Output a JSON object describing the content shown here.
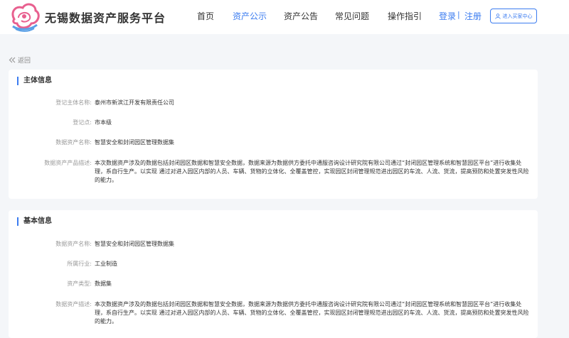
{
  "header": {
    "site_title": "无锡数据资产服务平台",
    "nav": [
      "首页",
      "资产公示",
      "资产公告",
      "常见问题",
      "操作指引"
    ],
    "active_nav": "资产公示",
    "login": "登录",
    "separator": "|",
    "register": "注册",
    "buyer_center": "进入买家中心"
  },
  "back_label": "返回",
  "subject_info": {
    "title": "主体信息",
    "rows": [
      {
        "label": "登记主体名称:",
        "value": "泰州市新滨江开发有限责任公司"
      },
      {
        "label": "登记点:",
        "value": "市本级"
      },
      {
        "label": "数据资产名称:",
        "value": "智慧安全和封闭园区管理数据集"
      },
      {
        "label": "数据资产产品描述:",
        "value": "本次数据资产涉及的数据包括封闭园区数据和智慧安全数据，数据来源为数据供方委托中通服咨询设计研究院有限公司通过“封闭园区管理系统和智慧园区平台”进行收集处理，系自行生产。以实现 通过对进入园区内部的人员、车辆、货物的立体化、全覆盖管控，实现园区封闭管理规范进出园区的车流、人流、货流，提高预防和处置突发性风险的能力。"
      }
    ]
  },
  "basic_info": {
    "title": "基本信息",
    "rows": [
      {
        "label": "数据资产名称:",
        "value": "智慧安全和封闭园区管理数据集"
      },
      {
        "label": "所属行业:",
        "value": "工业制造"
      },
      {
        "label": "资产类型:",
        "value": "数据集"
      },
      {
        "label": "数据资产描述:",
        "value": "本次数据资产涉及的数据包括封闭园区数据和智慧安全数据，数据来源为数据供方委托中通服咨询设计研究院有限公司通过“封闭园区管理系统和智慧园区平台”进行收集处理，系自行生产。以实现 通过对进入园区内部的人员、车辆、货物的立体化、全覆盖管控，实现园区封闭管理规范进出园区的车流、人流、货流，提高预防和处置突发性风险的能力。"
      }
    ]
  },
  "colors": {
    "accent": "#3b7cf0",
    "logo_pink": "#e8608f",
    "logo_blue": "#5aa0e6"
  },
  "icons": [
    "platform-logo",
    "double-chevron-left-icon",
    "user-icon"
  ]
}
